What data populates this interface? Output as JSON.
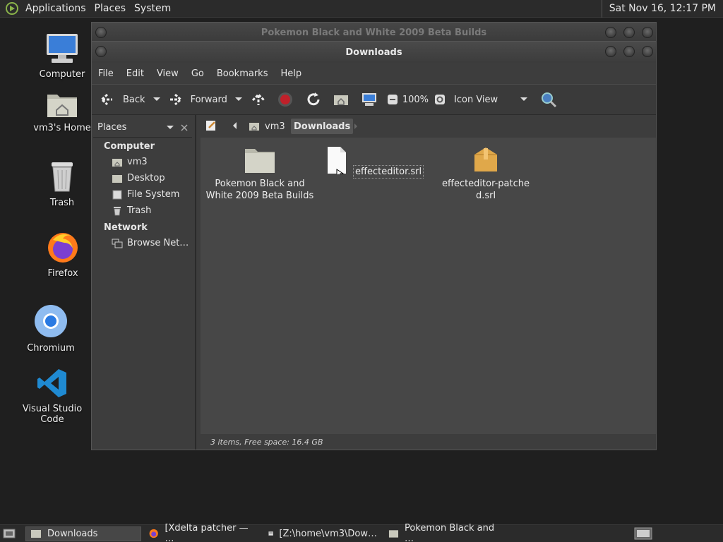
{
  "top_panel": {
    "menus": [
      "Applications",
      "Places",
      "System"
    ],
    "clock": "Sat Nov 16, 12:17 PM"
  },
  "desktop": {
    "icons": [
      {
        "label": "Computer",
        "icon": "computer-icon"
      },
      {
        "label": "vm3's Home",
        "icon": "home-folder-icon"
      },
      {
        "label": "Trash",
        "icon": "trash-icon"
      },
      {
        "label": "Firefox",
        "icon": "firefox-icon"
      },
      {
        "label": "Chromium",
        "icon": "chromium-icon"
      },
      {
        "label": "Visual Studio Code",
        "icon": "vscode-icon"
      }
    ]
  },
  "background_window": {
    "title": "Pokemon Black and White 2009 Beta Builds"
  },
  "window": {
    "title": "Downloads",
    "menubar": [
      "File",
      "Edit",
      "View",
      "Go",
      "Bookmarks",
      "Help"
    ],
    "toolbar": {
      "back": "Back",
      "forward": "Forward",
      "zoom": "100%",
      "view_mode": "Icon View"
    },
    "sidebar": {
      "combo": "Places",
      "sections": [
        {
          "title": "Computer",
          "items": [
            "vm3",
            "Desktop",
            "File System",
            "Trash"
          ]
        },
        {
          "title": "Network",
          "items": [
            "Browse Net…"
          ]
        }
      ]
    },
    "path": [
      "vm3",
      "Downloads"
    ],
    "files": [
      {
        "name": "Pokemon Black and White 2009 Beta Builds",
        "type": "folder"
      },
      {
        "name": "effecteditor.srl",
        "type": "file"
      },
      {
        "name": "effecteditor-patched.srl",
        "type": "package"
      }
    ],
    "status": "3 items, Free space: 16.4 GB"
  },
  "taskbar": {
    "tasks": [
      {
        "label": "Downloads",
        "icon": "folder-icon",
        "active": true
      },
      {
        "label": "[Xdelta patcher — …",
        "icon": "firefox-icon",
        "active": false
      },
      {
        "label": "[Z:\\home\\vm3\\Dow…",
        "icon": "wine-icon",
        "active": false
      },
      {
        "label": "Pokemon Black and …",
        "icon": "folder-icon",
        "active": false
      }
    ]
  },
  "colors": {
    "accent": "#8ab34a",
    "folder": "#d4d4c8",
    "package": "#e0a84a",
    "stop": "#c0202a"
  }
}
